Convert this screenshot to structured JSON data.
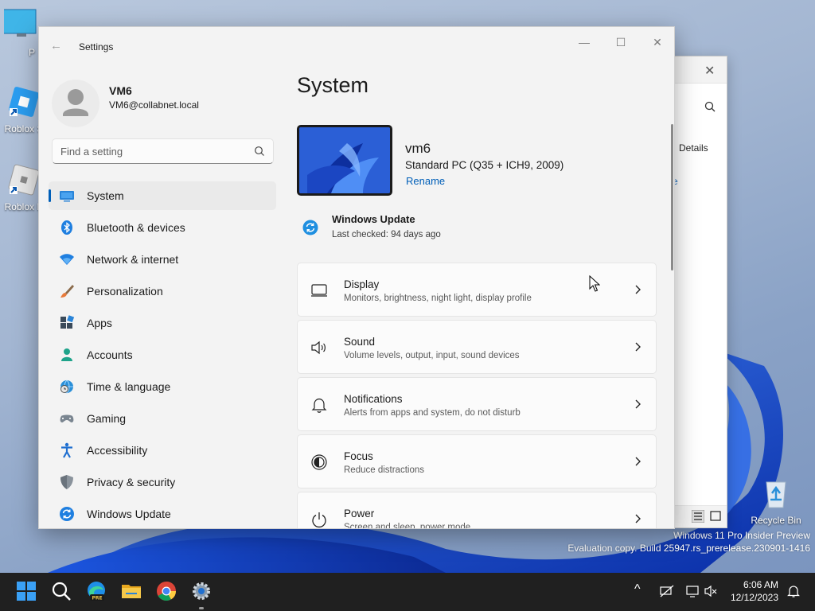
{
  "desktop": {
    "icons": [
      {
        "label": "This P",
        "name": "this-pc"
      },
      {
        "label": "Roblox S",
        "name": "roblox-studio"
      },
      {
        "label": "Roblox P",
        "name": "roblox-player"
      },
      {
        "label": "Recycle Bin",
        "name": "recycle-bin"
      }
    ],
    "watermark_line1": "Windows 11 Pro Insider Preview",
    "watermark_line2": "Evaluation copy. Build 25947.rs_prerelease.230901-1416"
  },
  "background_window": {
    "close_glyph": "✕",
    "details_label": "Details",
    "link_fragment": "e"
  },
  "settings": {
    "window_title": "Settings",
    "back_glyph": "←",
    "minimize_glyph": "—",
    "maximize_glyph": "☐",
    "close_glyph": "✕",
    "user": {
      "name": "VM6",
      "email": "VM6@collabnet.local"
    },
    "search_placeholder": "Find a setting",
    "nav": [
      {
        "label": "System",
        "icon": "system-icon",
        "active": true
      },
      {
        "label": "Bluetooth & devices",
        "icon": "bluetooth-icon"
      },
      {
        "label": "Network & internet",
        "icon": "wifi-icon"
      },
      {
        "label": "Personalization",
        "icon": "brush-icon"
      },
      {
        "label": "Apps",
        "icon": "apps-icon"
      },
      {
        "label": "Accounts",
        "icon": "person-icon"
      },
      {
        "label": "Time & language",
        "icon": "globe-clock-icon"
      },
      {
        "label": "Gaming",
        "icon": "gamepad-icon"
      },
      {
        "label": "Accessibility",
        "icon": "accessibility-icon"
      },
      {
        "label": "Privacy & security",
        "icon": "shield-icon"
      },
      {
        "label": "Windows Update",
        "icon": "update-icon"
      }
    ],
    "page_title": "System",
    "device": {
      "name": "vm6",
      "model": "Standard PC (Q35 + ICH9, 2009)",
      "rename_label": "Rename"
    },
    "windows_update": {
      "title": "Windows Update",
      "subtitle": "Last checked: 94 days ago"
    },
    "cards": [
      {
        "title": "Display",
        "subtitle": "Monitors, brightness, night light, display profile",
        "icon": "monitor-icon"
      },
      {
        "title": "Sound",
        "subtitle": "Volume levels, output, input, sound devices",
        "icon": "speaker-icon"
      },
      {
        "title": "Notifications",
        "subtitle": "Alerts from apps and system, do not disturb",
        "icon": "bell-icon"
      },
      {
        "title": "Focus",
        "subtitle": "Reduce distractions",
        "icon": "focus-icon"
      },
      {
        "title": "Power",
        "subtitle": "Screen and sleep, power mode",
        "icon": "power-icon"
      }
    ]
  },
  "taskbar": {
    "apps": [
      "start-icon",
      "search-icon",
      "edge-beta-icon",
      "file-explorer-icon",
      "chrome-icon",
      "settings-icon"
    ],
    "edge_badge": "PRE",
    "tray_chevron": "^",
    "time": "6:06 AM",
    "date": "12/12/2023"
  },
  "colors": {
    "accent": "#005fb8",
    "taskbar": "#202020",
    "window_bg": "#f3f3f3"
  }
}
